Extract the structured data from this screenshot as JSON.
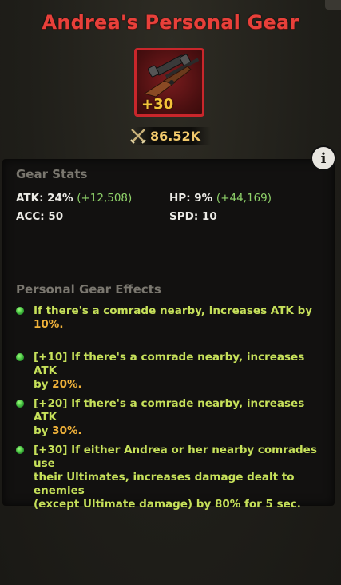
{
  "title": "Andrea's Personal Gear",
  "gear": {
    "level": "+30",
    "icon": "rifle-icon"
  },
  "power": {
    "value": "86.52K",
    "icon": "crossed-swords-icon"
  },
  "info_button": {
    "label": "i"
  },
  "stats": {
    "section_title": "Gear Stats",
    "atk_label": "ATK: 24%",
    "atk_bonus": "(+12,508)",
    "hp_label": "HP: 9%",
    "hp_bonus": "(+44,169)",
    "acc_label": "ACC: 50",
    "spd_label": "SPD: 10"
  },
  "effects": {
    "section_title": "Personal Gear Effects",
    "items": [
      {
        "line1": "If there's a comrade nearby, increases ATK by",
        "line2_pct": "10%."
      },
      {
        "line1": "[+10] If there's a comrade nearby, increases ATK",
        "line2_pre": "by ",
        "line2_pct": "20%."
      },
      {
        "line1": "[+20] If there's a comrade nearby, increases ATK",
        "line2_pre": "by ",
        "line2_pct": "30%."
      },
      {
        "line1": "[+30] If either Andrea or her nearby comrades use",
        "line2": "their Ultimates, increases damage dealt to enemies",
        "line3": "(except Ultimate damage) by 80% for 5 sec."
      }
    ]
  },
  "colors": {
    "title": "#e8403a",
    "gear_border": "#c9262b",
    "effect_text": "#c6e05a",
    "effect_pct": "#f0b23a",
    "bonus": "#8fd26a",
    "power": "#f1c96b"
  }
}
